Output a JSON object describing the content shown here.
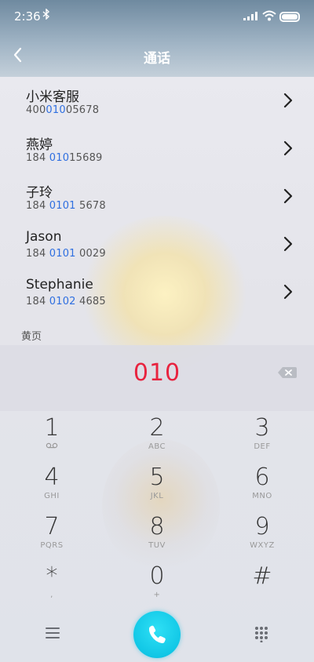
{
  "status_bar": {
    "time": "2:36",
    "bluetooth_icon": "bluetooth-icon",
    "signal_icon": "signal-icon",
    "wifi_icon": "wifi-icon",
    "battery_icon": "battery-icon"
  },
  "header": {
    "title": "通话",
    "back_icon": "chevron-left-icon"
  },
  "contacts": [
    {
      "name": "小米客服",
      "number_pre": "400",
      "number_hl": "010",
      "number_post": "05678"
    },
    {
      "name": "燕婷",
      "number_pre": "184 ",
      "number_hl": "010",
      "number_post": "15689"
    },
    {
      "name": "子玲",
      "number_pre": "184 ",
      "number_hl": "0101",
      "number_post": " 5678"
    },
    {
      "name": "Jason",
      "number_pre": "184 ",
      "number_hl": "0101",
      "number_post": " 0029"
    },
    {
      "name": "Stephanie",
      "number_pre": "184 ",
      "number_hl": "0102",
      "number_post": " 4685"
    }
  ],
  "section_label": "黄页",
  "dial_input": {
    "value": "010",
    "delete_icon": "backspace-icon"
  },
  "keypad": [
    {
      "digit": "1",
      "letters": ""
    },
    {
      "digit": "2",
      "letters": "ABC"
    },
    {
      "digit": "3",
      "letters": "DEF"
    },
    {
      "digit": "4",
      "letters": "GHI"
    },
    {
      "digit": "5",
      "letters": "JKL"
    },
    {
      "digit": "6",
      "letters": "MNO"
    },
    {
      "digit": "7",
      "letters": "PQRS"
    },
    {
      "digit": "8",
      "letters": "TUV"
    },
    {
      "digit": "9",
      "letters": "WXYZ"
    },
    {
      "digit": "*",
      "letters": ","
    },
    {
      "digit": "0",
      "letters": "+"
    },
    {
      "digit": "#",
      "letters": ""
    }
  ],
  "bottom_bar": {
    "menu_icon": "menu-icon",
    "call_icon": "phone-icon",
    "keypad_icon": "dialpad-icon"
  },
  "colors": {
    "accent_digits": "#e8233f",
    "match_highlight": "#2f6fe0",
    "call_button": "#11c7e6"
  }
}
